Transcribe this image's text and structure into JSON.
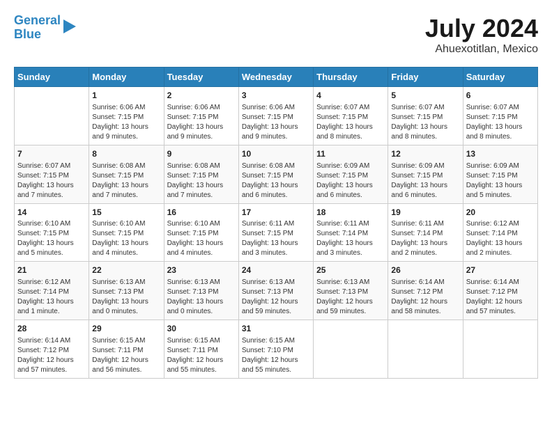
{
  "header": {
    "logo_line1": "General",
    "logo_line2": "Blue",
    "month": "July 2024",
    "location": "Ahuexotitlan, Mexico"
  },
  "weekdays": [
    "Sunday",
    "Monday",
    "Tuesday",
    "Wednesday",
    "Thursday",
    "Friday",
    "Saturday"
  ],
  "weeks": [
    [
      {
        "day": "",
        "content": ""
      },
      {
        "day": "1",
        "content": "Sunrise: 6:06 AM\nSunset: 7:15 PM\nDaylight: 13 hours and 9 minutes."
      },
      {
        "day": "2",
        "content": "Sunrise: 6:06 AM\nSunset: 7:15 PM\nDaylight: 13 hours and 9 minutes."
      },
      {
        "day": "3",
        "content": "Sunrise: 6:06 AM\nSunset: 7:15 PM\nDaylight: 13 hours and 9 minutes."
      },
      {
        "day": "4",
        "content": "Sunrise: 6:07 AM\nSunset: 7:15 PM\nDaylight: 13 hours and 8 minutes."
      },
      {
        "day": "5",
        "content": "Sunrise: 6:07 AM\nSunset: 7:15 PM\nDaylight: 13 hours and 8 minutes."
      },
      {
        "day": "6",
        "content": "Sunrise: 6:07 AM\nSunset: 7:15 PM\nDaylight: 13 hours and 8 minutes."
      }
    ],
    [
      {
        "day": "7",
        "content": "Sunrise: 6:07 AM\nSunset: 7:15 PM\nDaylight: 13 hours and 7 minutes."
      },
      {
        "day": "8",
        "content": "Sunrise: 6:08 AM\nSunset: 7:15 PM\nDaylight: 13 hours and 7 minutes."
      },
      {
        "day": "9",
        "content": "Sunrise: 6:08 AM\nSunset: 7:15 PM\nDaylight: 13 hours and 7 minutes."
      },
      {
        "day": "10",
        "content": "Sunrise: 6:08 AM\nSunset: 7:15 PM\nDaylight: 13 hours and 6 minutes."
      },
      {
        "day": "11",
        "content": "Sunrise: 6:09 AM\nSunset: 7:15 PM\nDaylight: 13 hours and 6 minutes."
      },
      {
        "day": "12",
        "content": "Sunrise: 6:09 AM\nSunset: 7:15 PM\nDaylight: 13 hours and 6 minutes."
      },
      {
        "day": "13",
        "content": "Sunrise: 6:09 AM\nSunset: 7:15 PM\nDaylight: 13 hours and 5 minutes."
      }
    ],
    [
      {
        "day": "14",
        "content": "Sunrise: 6:10 AM\nSunset: 7:15 PM\nDaylight: 13 hours and 5 minutes."
      },
      {
        "day": "15",
        "content": "Sunrise: 6:10 AM\nSunset: 7:15 PM\nDaylight: 13 hours and 4 minutes."
      },
      {
        "day": "16",
        "content": "Sunrise: 6:10 AM\nSunset: 7:15 PM\nDaylight: 13 hours and 4 minutes."
      },
      {
        "day": "17",
        "content": "Sunrise: 6:11 AM\nSunset: 7:15 PM\nDaylight: 13 hours and 3 minutes."
      },
      {
        "day": "18",
        "content": "Sunrise: 6:11 AM\nSunset: 7:14 PM\nDaylight: 13 hours and 3 minutes."
      },
      {
        "day": "19",
        "content": "Sunrise: 6:11 AM\nSunset: 7:14 PM\nDaylight: 13 hours and 2 minutes."
      },
      {
        "day": "20",
        "content": "Sunrise: 6:12 AM\nSunset: 7:14 PM\nDaylight: 13 hours and 2 minutes."
      }
    ],
    [
      {
        "day": "21",
        "content": "Sunrise: 6:12 AM\nSunset: 7:14 PM\nDaylight: 13 hours and 1 minute."
      },
      {
        "day": "22",
        "content": "Sunrise: 6:13 AM\nSunset: 7:13 PM\nDaylight: 13 hours and 0 minutes."
      },
      {
        "day": "23",
        "content": "Sunrise: 6:13 AM\nSunset: 7:13 PM\nDaylight: 13 hours and 0 minutes."
      },
      {
        "day": "24",
        "content": "Sunrise: 6:13 AM\nSunset: 7:13 PM\nDaylight: 12 hours and 59 minutes."
      },
      {
        "day": "25",
        "content": "Sunrise: 6:13 AM\nSunset: 7:13 PM\nDaylight: 12 hours and 59 minutes."
      },
      {
        "day": "26",
        "content": "Sunrise: 6:14 AM\nSunset: 7:12 PM\nDaylight: 12 hours and 58 minutes."
      },
      {
        "day": "27",
        "content": "Sunrise: 6:14 AM\nSunset: 7:12 PM\nDaylight: 12 hours and 57 minutes."
      }
    ],
    [
      {
        "day": "28",
        "content": "Sunrise: 6:14 AM\nSunset: 7:12 PM\nDaylight: 12 hours and 57 minutes."
      },
      {
        "day": "29",
        "content": "Sunrise: 6:15 AM\nSunset: 7:11 PM\nDaylight: 12 hours and 56 minutes."
      },
      {
        "day": "30",
        "content": "Sunrise: 6:15 AM\nSunset: 7:11 PM\nDaylight: 12 hours and 55 minutes."
      },
      {
        "day": "31",
        "content": "Sunrise: 6:15 AM\nSunset: 7:10 PM\nDaylight: 12 hours and 55 minutes."
      },
      {
        "day": "",
        "content": ""
      },
      {
        "day": "",
        "content": ""
      },
      {
        "day": "",
        "content": ""
      }
    ]
  ]
}
